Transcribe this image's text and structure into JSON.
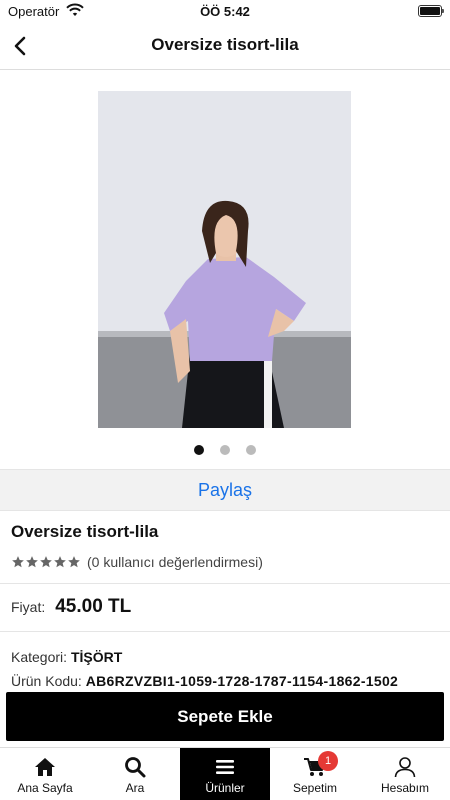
{
  "status_bar": {
    "carrier": "Operatör",
    "time": "ÖÖ 5:42"
  },
  "nav": {
    "title": "Oversize tisort-lila"
  },
  "gallery": {
    "image_count": 3,
    "active_index": 0
  },
  "share": {
    "label": "Paylaş"
  },
  "product": {
    "name": "Oversize tisort-lila",
    "rating_stars": 5,
    "rating_text": "(0 kullanıcı değerlendirmesi)",
    "price_label": "Fiyat:",
    "price": "45.00 TL",
    "category_label": "Kategori:",
    "category": "TİŞÖRT",
    "code_label": "Ürün Kodu:",
    "code": "AB6RZVZBI1-1059-1728-1787-1154-1862-1502"
  },
  "cart_button": {
    "label": "Sepete Ekle"
  },
  "tabs": [
    {
      "label": "Ana Sayfa",
      "icon": "home-icon"
    },
    {
      "label": "Ara",
      "icon": "search-icon"
    },
    {
      "label": "Ürünler",
      "icon": "menu-icon",
      "active": true
    },
    {
      "label": "Sepetim",
      "icon": "cart-icon",
      "badge": "1"
    },
    {
      "label": "Hesabım",
      "icon": "user-icon"
    }
  ],
  "colors": {
    "accent": "#1a73e8",
    "badge": "#e53935",
    "button": "#000000"
  }
}
